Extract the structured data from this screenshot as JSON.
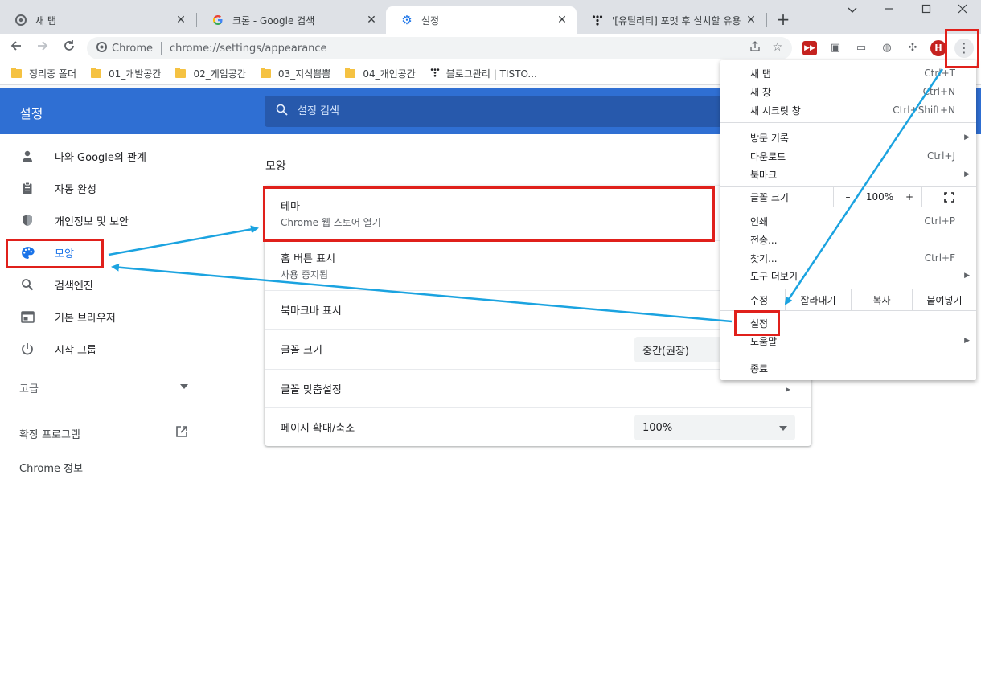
{
  "tabs": [
    {
      "title": "새 탭",
      "icon": "chrome-icon",
      "active": false
    },
    {
      "title": "크롬 - Google 검색",
      "icon": "google-icon",
      "active": false
    },
    {
      "title": "설정",
      "icon": "gear-icon",
      "active": true
    },
    {
      "title": "'[유틸리티] 포맷 후 설치할 유용",
      "icon": "tistory-icon",
      "active": false
    }
  ],
  "toolbar": {
    "site_label": "Chrome",
    "url": "chrome://settings/appearance",
    "avatar_letter": "H"
  },
  "bookmarks": [
    {
      "label": "정리중 폴더",
      "type": "folder"
    },
    {
      "label": "01_개발공간",
      "type": "folder"
    },
    {
      "label": "02_게임공간",
      "type": "folder"
    },
    {
      "label": "03_지식쁨쁨",
      "type": "folder"
    },
    {
      "label": "04_개인공간",
      "type": "folder"
    },
    {
      "label": "블로그관리 | TISTO...",
      "type": "site"
    }
  ],
  "header": {
    "title": "설정",
    "search_placeholder": "설정 검색"
  },
  "sidebar": {
    "items": [
      {
        "label": "나와 Google의 관계",
        "icon": "person-icon"
      },
      {
        "label": "자동 완성",
        "icon": "clipboard-icon"
      },
      {
        "label": "개인정보 및 보안",
        "icon": "shield-icon"
      },
      {
        "label": "모양",
        "icon": "palette-icon"
      },
      {
        "label": "검색엔진",
        "icon": "search-icon"
      },
      {
        "label": "기본 브라우저",
        "icon": "browser-icon"
      },
      {
        "label": "시작 그룹",
        "icon": "power-icon"
      }
    ],
    "advanced": "고급",
    "extensions": "확장 프로그램",
    "about": "Chrome 정보"
  },
  "main": {
    "section_title": "모양",
    "rows": [
      {
        "label": "테마",
        "sub": "Chrome 웹 스토어 열기"
      },
      {
        "label": "홈 버튼 표시",
        "sub": "사용 중지됨"
      },
      {
        "label": "북마크바 표시"
      },
      {
        "label": "글꼴 크기",
        "value": "중간(권장)"
      },
      {
        "label": "글꼴 맞춤설정"
      },
      {
        "label": "페이지 확대/축소",
        "value": "100%"
      }
    ]
  },
  "menu": {
    "new_tab": "새 탭",
    "new_tab_sc": "Ctrl+T",
    "new_window": "새 창",
    "new_window_sc": "Ctrl+N",
    "incognito": "새 시크릿 창",
    "incognito_sc": "Ctrl+Shift+N",
    "history": "방문 기록",
    "downloads": "다운로드",
    "downloads_sc": "Ctrl+J",
    "bookmarks": "북마크",
    "zoom_label": "글꼴 크기",
    "zoom_minus": "–",
    "zoom_value": "100%",
    "zoom_plus": "+",
    "print": "인쇄",
    "print_sc": "Ctrl+P",
    "cast": "전송...",
    "find": "찾기...",
    "find_sc": "Ctrl+F",
    "more_tools": "도구 더보기",
    "edit": "수정",
    "cut": "잘라내기",
    "copy": "복사",
    "paste": "붙여넣기",
    "settings": "설정",
    "help": "도움말",
    "exit": "종료"
  },
  "colors": {
    "accent": "#1a73e8",
    "header_bg": "#2f6fd3",
    "highlight": "#e0201b",
    "arrow": "#1ba3e0"
  }
}
